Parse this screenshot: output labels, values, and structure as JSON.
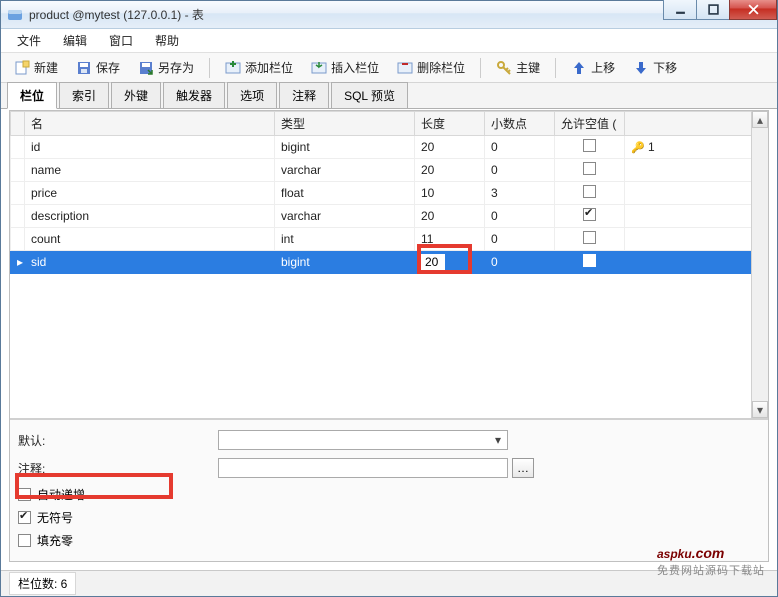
{
  "window": {
    "title": "product @mytest (127.0.0.1) - 表"
  },
  "menu": {
    "file": "文件",
    "edit": "编辑",
    "window": "窗口",
    "help": "帮助"
  },
  "toolbar": {
    "new": "新建",
    "save": "保存",
    "saveas": "另存为",
    "addfield": "添加栏位",
    "insertfield": "插入栏位",
    "delfield": "删除栏位",
    "primarykey": "主键",
    "moveup": "上移",
    "movedown": "下移"
  },
  "tabs": {
    "fields": "栏位",
    "indexes": "索引",
    "fks": "外键",
    "triggers": "触发器",
    "options": "选项",
    "comment": "注释",
    "sqlpreview": "SQL 预览"
  },
  "grid": {
    "headers": {
      "name": "名",
      "type": "类型",
      "length": "长度",
      "decimals": "小数点",
      "nullable": "允许空值 ("
    },
    "rows": [
      {
        "name": "id",
        "type": "bigint",
        "length": "20",
        "decimals": "0",
        "nullable": false,
        "pk": "1"
      },
      {
        "name": "name",
        "type": "varchar",
        "length": "20",
        "decimals": "0",
        "nullable": false
      },
      {
        "name": "price",
        "type": "float",
        "length": "10",
        "decimals": "3",
        "nullable": false
      },
      {
        "name": "description",
        "type": "varchar",
        "length": "20",
        "decimals": "0",
        "nullable": true
      },
      {
        "name": "count",
        "type": "int",
        "length": "11",
        "decimals": "0",
        "nullable": false
      },
      {
        "name": "sid",
        "type": "bigint",
        "length": "20",
        "decimals": "0",
        "nullable": false
      }
    ],
    "selected_index": 5
  },
  "props": {
    "default_label": "默认:",
    "default_value": "",
    "comment_label": "注释:",
    "comment_value": "",
    "autoinc_label": "自动递增",
    "autoinc": false,
    "unsigned_label": "无符号",
    "unsigned": true,
    "zerofill_label": "填充零",
    "zerofill": false
  },
  "status": {
    "fieldcount": "栏位数: 6"
  },
  "watermark": {
    "brand": "aspku",
    "tld": ".com",
    "sub": "免费网站源码下载站"
  }
}
